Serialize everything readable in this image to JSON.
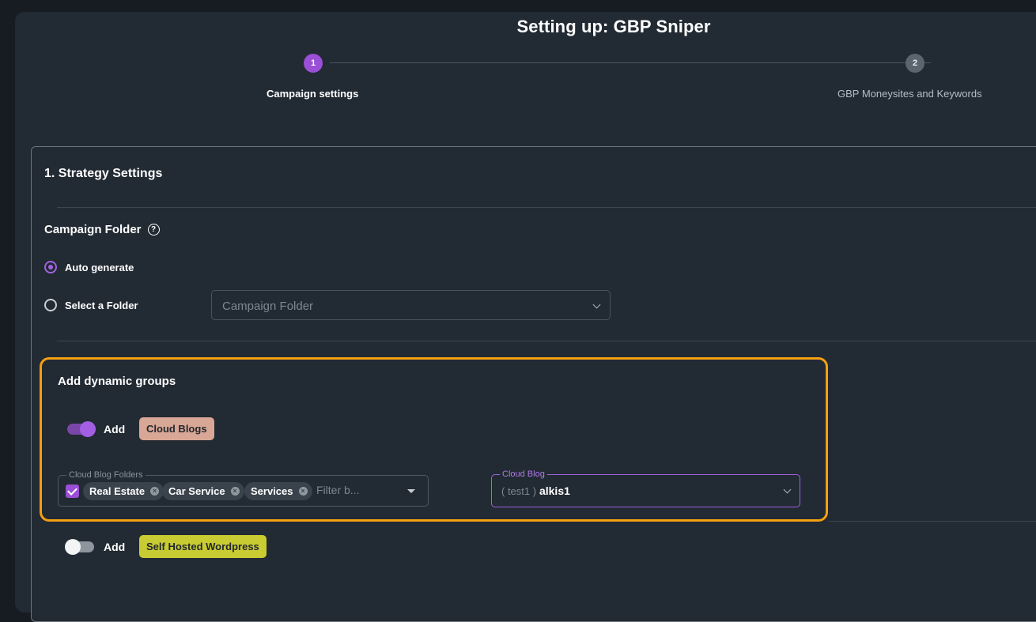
{
  "header": {
    "title": "Setting up: GBP Sniper"
  },
  "stepper": {
    "steps": [
      {
        "number": "1",
        "label": "Campaign settings"
      },
      {
        "number": "2",
        "label": "GBP Moneysites and Keywords"
      }
    ]
  },
  "strategy": {
    "title": "1. Strategy Settings",
    "campaign_folder": {
      "label": "Campaign Folder",
      "options": [
        {
          "label": "Auto generate",
          "selected": true
        },
        {
          "label": "Select a Folder",
          "selected": false
        }
      ],
      "select_placeholder": "Campaign Folder"
    },
    "dynamic_groups": {
      "title": "Add dynamic groups",
      "groups": [
        {
          "toggle_label": "Add",
          "enabled": true,
          "tag": "Cloud Blogs",
          "tag_color": "#d9a795"
        },
        {
          "toggle_label": "Add",
          "enabled": false,
          "tag": "Self Hosted Wordpress",
          "tag_color": "#c8cb32"
        }
      ],
      "cloud_blog_folders": {
        "legend": "Cloud Blog Folders",
        "chips": [
          "Real Estate",
          "Car Service",
          "Services"
        ],
        "filter_placeholder": "Filter b..."
      },
      "cloud_blog": {
        "legend": "Cloud Blog",
        "prefix": "( test1 )",
        "value": "alkis1"
      }
    }
  },
  "colors": {
    "accent": "#9a4fd6",
    "highlight": "#f4a012",
    "background": "#222a33"
  }
}
